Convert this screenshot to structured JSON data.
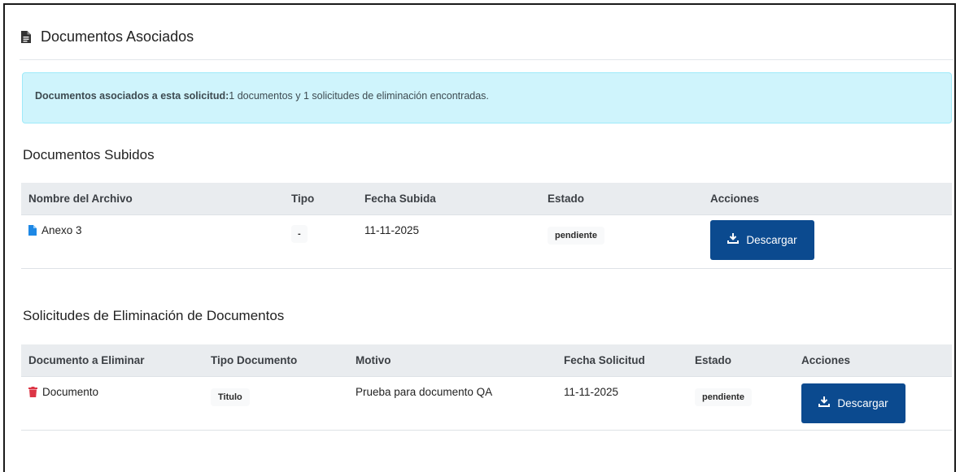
{
  "header": {
    "title": "Documentos Asociados",
    "icon": "file-document-icon"
  },
  "alert": {
    "strong": "Documentos asociados a esta solicitud:",
    "text": "1 documentos y 1 solicitudes de eliminación encontradas."
  },
  "uploaded": {
    "title": "Documentos Subidos",
    "columns": [
      "Nombre del Archivo",
      "Tipo",
      "Fecha Subida",
      "Estado",
      "Acciones"
    ],
    "rows": [
      {
        "name": "Anexo 3",
        "icon": "file-blue-icon",
        "type": "-",
        "date": "11-11-2025",
        "status": "pendiente",
        "action": "Descargar"
      }
    ]
  },
  "deletions": {
    "title": "Solicitudes de Eliminación de Documentos",
    "columns": [
      "Documento a Eliminar",
      "Tipo Documento",
      "Motivo",
      "Fecha Solicitud",
      "Estado",
      "Acciones"
    ],
    "rows": [
      {
        "name": "Documento",
        "icon": "trash-red-icon",
        "type": "Titulo",
        "reason": "Prueba para documento QA",
        "date": "11-11-2025",
        "status": "pendiente",
        "action": "Descargar"
      }
    ]
  },
  "colors": {
    "accent": "#0b4a8f",
    "info_bg": "#cff4fc",
    "trash": "#dc3545",
    "file": "#1e88e5"
  }
}
